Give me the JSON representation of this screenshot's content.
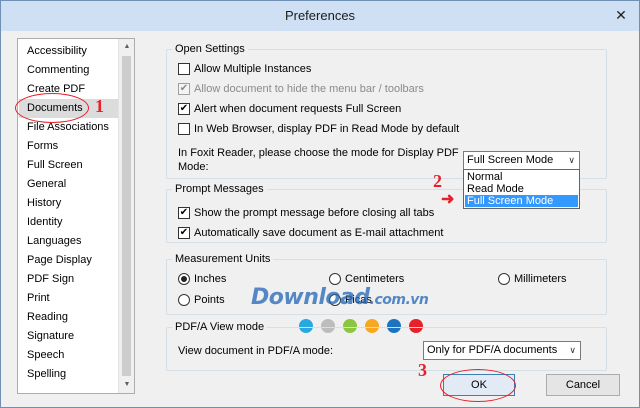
{
  "window": {
    "title": "Preferences",
    "close_glyph": "✕"
  },
  "sidebar": {
    "items": [
      {
        "label": "Accessibility"
      },
      {
        "label": "Commenting"
      },
      {
        "label": "Create PDF"
      },
      {
        "label": "Documents"
      },
      {
        "label": "File Associations"
      },
      {
        "label": "Forms"
      },
      {
        "label": "Full Screen"
      },
      {
        "label": "General"
      },
      {
        "label": "History"
      },
      {
        "label": "Identity"
      },
      {
        "label": "Languages"
      },
      {
        "label": "Page Display"
      },
      {
        "label": "PDF Sign"
      },
      {
        "label": "Print"
      },
      {
        "label": "Reading"
      },
      {
        "label": "Signature"
      },
      {
        "label": "Speech"
      },
      {
        "label": "Spelling"
      }
    ],
    "selected": "Documents"
  },
  "open_settings": {
    "title": "Open Settings",
    "allow_multiple": {
      "label": "Allow Multiple Instances",
      "checked": false
    },
    "hide_menu_bar": {
      "label": "Allow document to hide the menu bar / toolbars",
      "checked": true,
      "disabled": true
    },
    "alert_full_screen": {
      "label": "Alert when document requests Full Screen",
      "checked": true
    },
    "web_browser_read_mode": {
      "label": "In Web Browser, display PDF in Read Mode by default",
      "checked": false
    },
    "display_mode_label_line1": "In Foxit Reader, please choose the mode for Display PDF",
    "display_mode_label_line2": "Mode:",
    "display_mode_value": "Full Screen Mode",
    "display_mode_options": [
      "Normal",
      "Read Mode",
      "Full Screen Mode"
    ]
  },
  "prompt_messages": {
    "title": "Prompt Messages",
    "show_prompt": {
      "label": "Show the prompt message before closing all tabs",
      "checked": true
    },
    "auto_save_email": {
      "label": "Automatically save document as E-mail attachment",
      "checked": true
    }
  },
  "measurement_units": {
    "title": "Measurement Units",
    "inches": {
      "label": "Inches",
      "selected": true
    },
    "centimeters": {
      "label": "Centimeters",
      "selected": false
    },
    "millimeters": {
      "label": "Millimeters",
      "selected": false
    },
    "points": {
      "label": "Points",
      "selected": false
    },
    "picas": {
      "label": "Picas",
      "selected": false
    }
  },
  "pdfa": {
    "title": "PDF/A View mode",
    "label": "View document in PDF/A mode:",
    "value": "Only for PDF/A documents"
  },
  "buttons": {
    "ok": "OK",
    "cancel": "Cancel"
  },
  "annotations": {
    "step1": "1",
    "step2": "2",
    "step3": "3",
    "arrow": "➜"
  },
  "watermark": {
    "text": "Download",
    "suffix": ".com.vn",
    "dots": [
      "#29a8e0",
      "#bdbdbd",
      "#8cc63f",
      "#f7a823",
      "#1e73be",
      "#e8202a"
    ]
  },
  "icons": {
    "check": "check-icon",
    "chevron": "chevron-down-icon",
    "close": "close-icon"
  },
  "colors": {
    "selection": "#3399ff",
    "annotation": "#e8202a",
    "default_button_border": "#3c7fb1"
  }
}
